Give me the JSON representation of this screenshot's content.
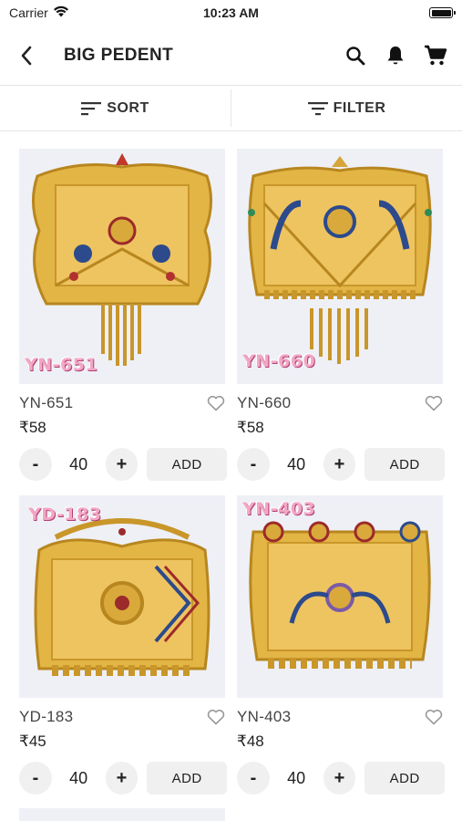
{
  "status": {
    "carrier": "Carrier",
    "time": "10:23 AM"
  },
  "header": {
    "title": "BIG PEDENT"
  },
  "toolbar": {
    "sort_label": "SORT",
    "filter_label": "FILTER"
  },
  "products": [
    {
      "code_tag": "YN-651",
      "name": "YN-651",
      "price": "₹58",
      "qty": "40",
      "add_label": "ADD",
      "minus": "-",
      "plus": "+"
    },
    {
      "code_tag": "YN-660",
      "name": "YN-660",
      "price": "₹58",
      "qty": "40",
      "add_label": "ADD",
      "minus": "-",
      "plus": "+"
    },
    {
      "code_tag": "YD-183",
      "name": "YD-183",
      "price": "₹45",
      "qty": "40",
      "add_label": "ADD",
      "minus": "-",
      "plus": "+"
    },
    {
      "code_tag": "YN-403",
      "name": "YN-403",
      "price": "₹48",
      "qty": "40",
      "add_label": "ADD",
      "minus": "-",
      "plus": "+"
    }
  ],
  "colors": {
    "gold": "#e2b545",
    "gold_dark": "#b8861f",
    "tag_pink": "#f2a7c4",
    "button_bg": "#f0f0f0"
  }
}
